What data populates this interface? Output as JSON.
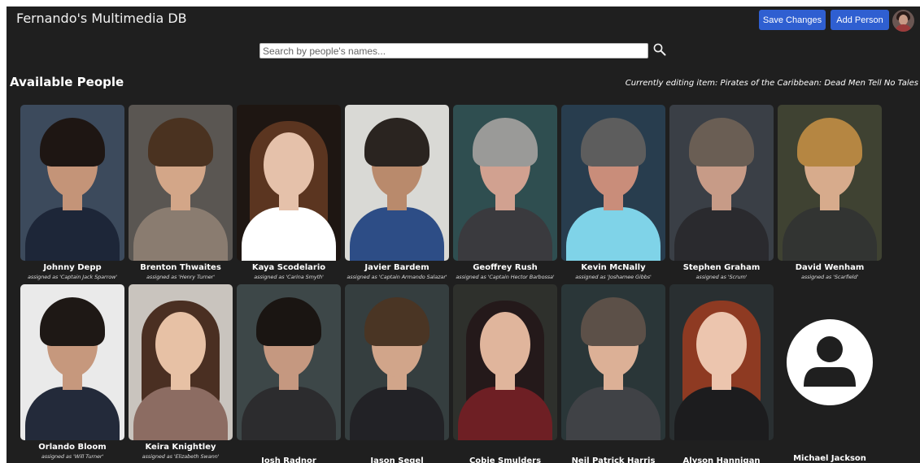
{
  "app": {
    "title": "Fernando's Multimedia DB",
    "accent_color": "#2f5fd1"
  },
  "header": {
    "save_label": "Save Changes",
    "add_label": "Add Person",
    "avatar_icon": "user-avatar"
  },
  "search": {
    "placeholder": "Search by people's names...",
    "value": "",
    "icon": "search-icon"
  },
  "main": {
    "section_title": "Available People",
    "editing_text": "Currently editing item: Pirates of the Caribbean: Dead Men Tell No Tales"
  },
  "people": [
    {
      "name": "Johnny Depp",
      "assigned": "assigned as 'Captain Jack Sparrow'"
    },
    {
      "name": "Brenton Thwaites",
      "assigned": "assigned as 'Henry Turner'"
    },
    {
      "name": "Kaya Scodelario",
      "assigned": "assigned as 'Carina Smyth'"
    },
    {
      "name": "Javier Bardem",
      "assigned": "assigned as 'Captain Armando Salazar'"
    },
    {
      "name": "Geoffrey Rush",
      "assigned": "assigned as 'Captain Hector Barbossa'"
    },
    {
      "name": "Kevin McNally",
      "assigned": "assigned as 'Joshamee Gibbs'"
    },
    {
      "name": "Stephen Graham",
      "assigned": "assigned as 'Scrum'"
    },
    {
      "name": "David Wenham",
      "assigned": "assigned as 'Scarfield'"
    },
    {
      "name": "Orlando Bloom",
      "assigned": "assigned as 'Will Turner'"
    },
    {
      "name": "Keira Knightley",
      "assigned": "assigned as 'Elizabeth Swann'"
    },
    {
      "name": "Josh Radnor"
    },
    {
      "name": "Jason Segel"
    },
    {
      "name": "Cobie Smulders"
    },
    {
      "name": "Neil Patrick Harris"
    },
    {
      "name": "Alyson Hannigan"
    },
    {
      "name": "Michael Jackson",
      "photo_icon": "default-person-icon"
    }
  ]
}
